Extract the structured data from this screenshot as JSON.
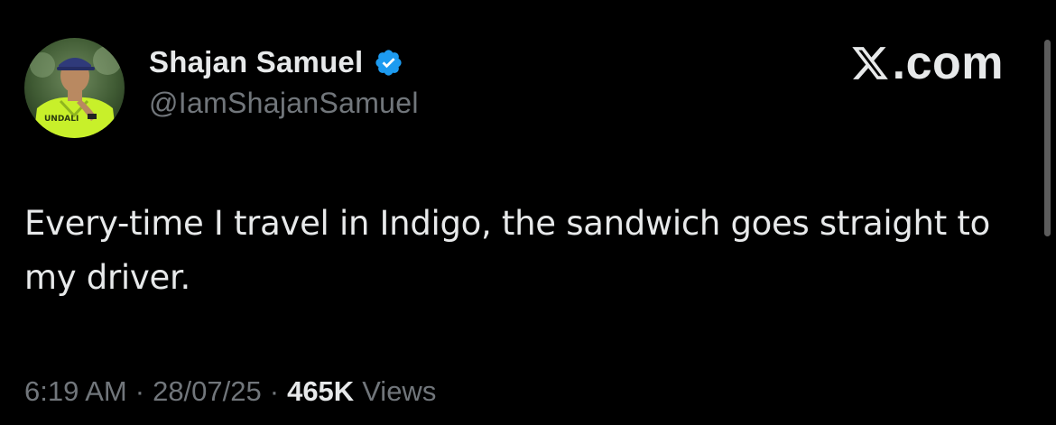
{
  "author": {
    "display_name": "Shajan Samuel",
    "handle": "@IamShajanSamuel",
    "verified": true,
    "badge_color": "#1d9bf0"
  },
  "brand": {
    "text": ".com"
  },
  "tweet": {
    "text": "Every-time I travel in Indigo, the sandwich goes straight to my driver.",
    "time": "6:19 AM",
    "date": "28/07/25",
    "separator": "·",
    "views_count": "465K",
    "views_label": "Views"
  },
  "colors": {
    "background": "#000000",
    "primary_text": "#e7e9ea",
    "secondary_text": "#71767b"
  }
}
